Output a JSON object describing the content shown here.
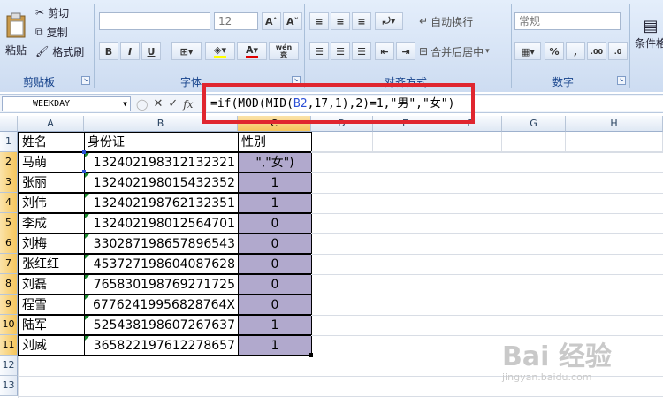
{
  "ribbon": {
    "clipboard": {
      "label": "剪贴板",
      "paste": "粘贴",
      "cut": "剪切",
      "copy": "复制",
      "format_painter": "格式刷"
    },
    "font": {
      "label": "字体",
      "size_value": "12",
      "bold": "B",
      "italic": "I",
      "underline": "U",
      "grow": "A˄",
      "shrink": "A˅",
      "wen": "wén",
      "wen_char": "变"
    },
    "alignment": {
      "label": "对齐方式",
      "wrap_text": "自动换行",
      "merge_center": "合并后居中"
    },
    "number": {
      "label": "数字",
      "format_value": "常规",
      "percent": "%",
      "comma": ","
    },
    "styles": {
      "cond_format": "条件格"
    }
  },
  "formula_bar": {
    "name_box": "WEEKDAY",
    "cancel": "✕",
    "enter": "✓",
    "fx": "fx",
    "formula_parts": [
      "=if(MOD(MID(",
      "B2",
      ",17,1),2)=1,\"男\",\"女\")"
    ]
  },
  "columns": [
    "A",
    "B",
    "C",
    "D",
    "E",
    "F",
    "G",
    "H"
  ],
  "rows": [
    "1",
    "2",
    "3",
    "4",
    "5",
    "6",
    "7",
    "8",
    "9",
    "10",
    "11",
    "12",
    "13"
  ],
  "headers": {
    "name": "姓名",
    "id": "身份证",
    "gender": "性别"
  },
  "records": [
    {
      "name": "马萌",
      "id": "132402198312132321",
      "gender": "\",\"女\")"
    },
    {
      "name": "张丽",
      "id": "132402198015432352",
      "gender": "1"
    },
    {
      "name": "刘伟",
      "id": "132402198762132351",
      "gender": "1"
    },
    {
      "name": "李成",
      "id": "132402198012564701",
      "gender": "0"
    },
    {
      "name": "刘梅",
      "id": "330287198657896543",
      "gender": "0"
    },
    {
      "name": "张红红",
      "id": "453727198604087628",
      "gender": "0"
    },
    {
      "name": "刘磊",
      "id": "765830198769271725",
      "gender": "0"
    },
    {
      "name": "程雪",
      "id": "67762419956828764X",
      "gender": "0"
    },
    {
      "name": "陆军",
      "id": "525438198607267637",
      "gender": "1"
    },
    {
      "name": "刘威",
      "id": "365822197612278657",
      "gender": "1"
    }
  ],
  "watermark": "Bai 经验",
  "watermark_sub": "jingyan.baidu.com",
  "colors": {
    "highlight": "#b1a9cd",
    "callout": "#e0262f",
    "ribbon": "#dbe6f6"
  }
}
